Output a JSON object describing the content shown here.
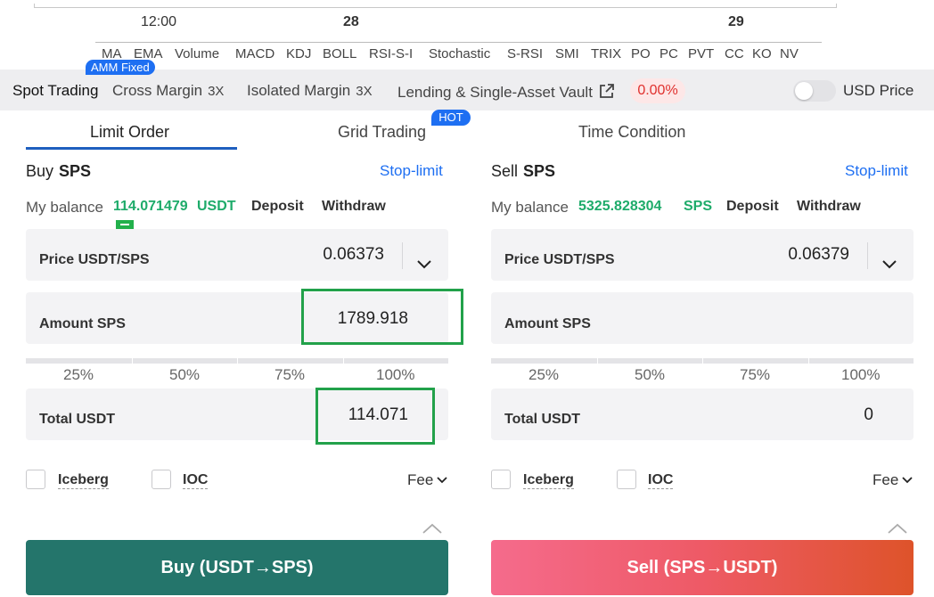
{
  "chart": {
    "axis_labels": [
      {
        "text": "12:00",
        "bold": false
      },
      {
        "text": "28",
        "bold": true
      },
      {
        "text": "29",
        "bold": true
      }
    ],
    "indicators": [
      "MA",
      "EMA",
      "Volume",
      "MACD",
      "KDJ",
      "BOLL",
      "RSI-S-I",
      "Stochastic",
      "S-RSI",
      "SMI",
      "TRIX",
      "PO",
      "PC",
      "PVT",
      "CC",
      "KO",
      "NV"
    ],
    "amm_badge": "AMM Fixed"
  },
  "trading_types": {
    "spot": "Spot Trading",
    "cross": "Cross Margin",
    "cross_lev": "3X",
    "isolated": "Isolated Margin",
    "isolated_lev": "3X",
    "lending": "Lending & Single-Asset Vault",
    "rate": "0.00%",
    "usd_price": "USD Price",
    "usd_price_enabled": false
  },
  "order_tabs": {
    "limit": "Limit Order",
    "grid": "Grid Trading",
    "grid_badge": "HOT",
    "time": "Time Condition",
    "active": "limit"
  },
  "buy": {
    "action": "Buy",
    "asset": "SPS",
    "stop_limit": "Stop-limit",
    "balance_label": "My balance",
    "balance_value": "114.071479",
    "balance_unit": "USDT",
    "deposit": "Deposit",
    "withdraw": "Withdraw",
    "price_label": "Price USDT/SPS",
    "price_value": "0.06373",
    "amount_label": "Amount SPS",
    "amount_value": "1789.918",
    "total_label": "Total USDT",
    "total_value": "114.071",
    "button": "Buy (USDT→SPS)"
  },
  "sell": {
    "action": "Sell",
    "asset": "SPS",
    "stop_limit": "Stop-limit",
    "balance_label": "My balance",
    "balance_value": "5325.828304",
    "balance_unit": "SPS",
    "deposit": "Deposit",
    "withdraw": "Withdraw",
    "price_label": "Price USDT/SPS",
    "price_value": "0.06379",
    "amount_label": "Amount SPS",
    "amount_value": "",
    "total_label": "Total USDT",
    "total_value": "0",
    "button": "Sell (SPS→USDT)"
  },
  "percentages": [
    "25%",
    "50%",
    "75%",
    "100%"
  ],
  "options": {
    "iceberg": "Iceberg",
    "ioc": "IOC",
    "fee": "Fee"
  },
  "colors": {
    "accent": "#1e6ff2",
    "buy": "#24756b",
    "sell_start": "#f56b8c",
    "sell_end": "#de532a",
    "balance": "#1eab6a",
    "rate": "#e0302d",
    "highlight": "#22a14a"
  }
}
